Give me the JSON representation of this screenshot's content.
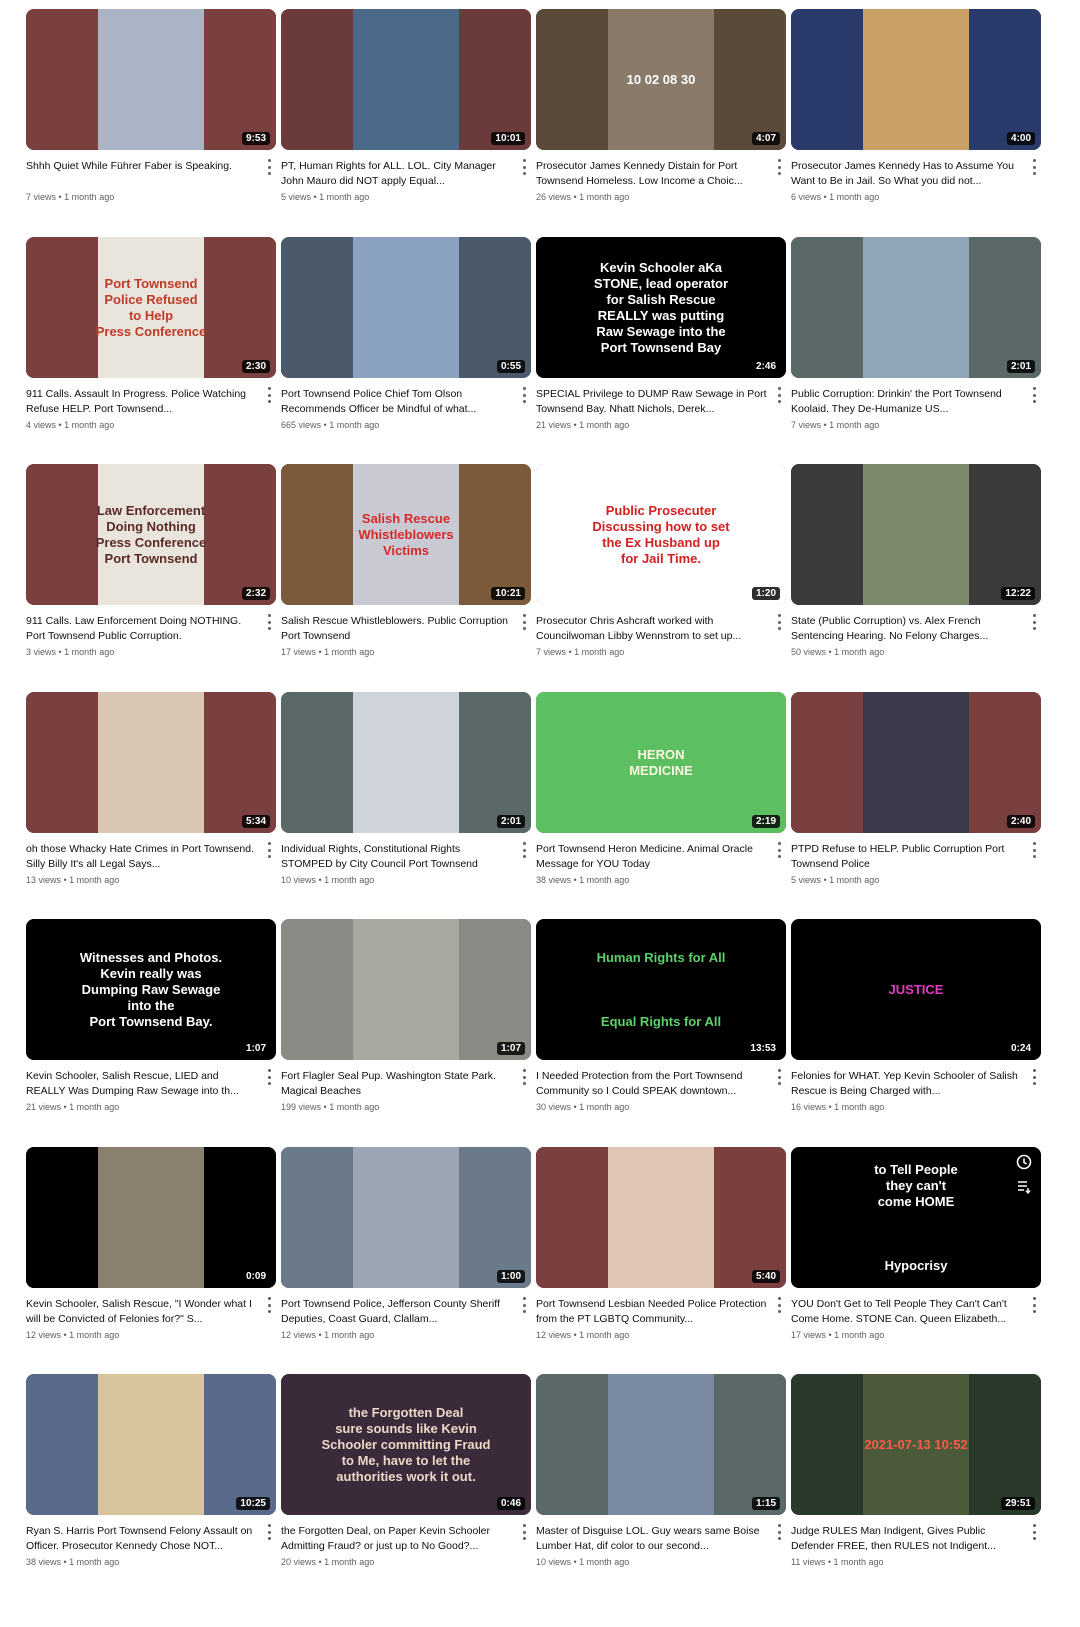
{
  "videos": [
    {
      "title": "Shhh Quiet While Führer Faber is Speaking.",
      "views": "7 views",
      "age": "1 month ago",
      "duration": "9:53",
      "overlay": "",
      "thumb": "#7a4040",
      "center": "#aab4c4",
      "fg": "#ffffff"
    },
    {
      "title": "PT, Human Rights for ALL. LOL. City Manager John Mauro did NOT apply Equal...",
      "views": "5 views",
      "age": "1 month ago",
      "duration": "10:01",
      "overlay": "",
      "thumb": "#6b3a3a",
      "center": "#4b6a8a",
      "fg": "#ffffff"
    },
    {
      "title": "Prosecutor James Kennedy Distain for Port Townsend Homeless. Low Income a Choic...",
      "views": "26 views",
      "age": "1 month ago",
      "duration": "4:07",
      "overlay": "10 02 08 30",
      "thumb": "#5a4a3a",
      "center": "#8a7a6a",
      "fg": "#ffffff"
    },
    {
      "title": "Prosecutor James Kennedy Has to Assume You Want to Be in Jail. So What you did not...",
      "views": "6 views",
      "age": "1 month ago",
      "duration": "4:00",
      "overlay": "",
      "thumb": "#2a3a6a",
      "center": "#c9a066",
      "fg": "#ffffff"
    },
    {
      "title": "911 Calls. Assault In Progress. Police Watching Refuse HELP. Port Townsend...",
      "views": "4 views",
      "age": "1 month ago",
      "duration": "2:30",
      "overlay": "Port Townsend\nPolice Refused\nto Help\nPress Conference",
      "thumb": "#7a4040",
      "center": "#e9e4dc",
      "fg": "#c23a2a"
    },
    {
      "title": "Port Townsend Police Chief Tom Olson Recommends Officer be Mindful of what...",
      "views": "665 views",
      "age": "1 month ago",
      "duration": "0:55",
      "overlay": "",
      "thumb": "#4a5a6a",
      "center": "#8aa2c0",
      "fg": "#ffffff"
    },
    {
      "title": "SPECIAL Privilege to DUMP Raw Sewage in Port Townsend Bay. Nhatt Nichols, Derek...",
      "views": "21 views",
      "age": "1 month ago",
      "duration": "2:46",
      "overlay": "Kevin Schooler aKa\nSTONE, lead operator\nfor Salish Rescue\nREALLY was putting\nRaw Sewage into the\nPort Townsend Bay",
      "thumb": "#000000",
      "center": "#000000",
      "fg": "#ffffff"
    },
    {
      "title": "Public Corruption: Drinkin' the Port Townsend Koolaid. They De-Humanize US...",
      "views": "7 views",
      "age": "1 month ago",
      "duration": "2:01",
      "overlay": "",
      "thumb": "#5a6868",
      "center": "#8fa6b8",
      "fg": "#ffffff"
    },
    {
      "title": "911 Calls. Law Enforcement Doing NOTHING. Port Townsend Public Corruption.",
      "views": "3 views",
      "age": "1 month ago",
      "duration": "2:32",
      "overlay": "Law Enforcement\nDoing Nothing\nPress Conference\nPort Townsend",
      "thumb": "#7a4040",
      "center": "#e9e4dc",
      "fg": "#5a2a2a"
    },
    {
      "title": "Salish Rescue Whistleblowers. Public Corruption Port Townsend",
      "views": "17 views",
      "age": "1 month ago",
      "duration": "10:21",
      "overlay": "Salish Rescue\nWhistleblowers\nVictims",
      "thumb": "#7a5a3a",
      "center": "#c9c9d4",
      "fg": "#d42a2a"
    },
    {
      "title": "Prosecutor Chris Ashcraft worked with Councilwoman Libby Wennstrom to set up...",
      "views": "7 views",
      "age": "1 month ago",
      "duration": "1:20",
      "overlay": "Public Prosecuter\nDiscussing how to set\nthe Ex Husband up\nfor Jail Time.",
      "thumb": "#ffffff",
      "center": "#ffffff",
      "fg": "#d42020"
    },
    {
      "title": "State (Public Corruption) vs. Alex French Sentencing Hearing. No Felony Charges...",
      "views": "50 views",
      "age": "1 month ago",
      "duration": "12:22",
      "overlay": "",
      "thumb": "#3a3a3a",
      "center": "#7a8a6a",
      "fg": "#ffffff"
    },
    {
      "title": "oh those Whacky Hate Crimes in Port Townsend. Silly Billy It's all Legal Says...",
      "views": "13 views",
      "age": "1 month ago",
      "duration": "5:34",
      "overlay": "",
      "thumb": "#7a4040",
      "center": "#d9c6b4",
      "fg": "#ffffff"
    },
    {
      "title": "Individual Rights, Constitutional Rights STOMPED by City Council Port Townsend",
      "views": "10 views",
      "age": "1 month ago",
      "duration": "2:01",
      "overlay": "",
      "thumb": "#5a6868",
      "center": "#cfd3da",
      "fg": "#ffffff"
    },
    {
      "title": "Port Townsend Heron Medicine. Animal Oracle Message for YOU Today",
      "views": "38 views",
      "age": "1 month ago",
      "duration": "2:19",
      "overlay": "HERON\nMEDICINE",
      "thumb": "#5cc063",
      "center": "#5cc063",
      "fg": "#fff6e0"
    },
    {
      "title": "PTPD Refuse to HELP. Public Corruption Port Townsend Police",
      "views": "5 views",
      "age": "1 month ago",
      "duration": "2:40",
      "overlay": "",
      "thumb": "#7a4040",
      "center": "#3a3a4a",
      "fg": "#ffffff"
    },
    {
      "title": "Kevin Schooler, Salish Rescue, LIED and REALLY Was Dumping Raw Sewage into th...",
      "views": "21 views",
      "age": "1 month ago",
      "duration": "1:07",
      "overlay": "Witnesses and Photos.\nKevin really was\nDumping Raw Sewage\ninto the\nPort Townsend Bay.",
      "thumb": "#000000",
      "center": "#000000",
      "fg": "#ffffff"
    },
    {
      "title": "Fort Flagler Seal Pup. Washington State Park. Magical Beaches",
      "views": "199 views",
      "age": "1 month ago",
      "duration": "1:07",
      "overlay": "",
      "thumb": "#8a8a84",
      "center": "#a8a8a0",
      "fg": "#ffffff"
    },
    {
      "title": "I Needed Protection from the Port Townsend Community so I Could SPEAK downtown...",
      "views": "30 views",
      "age": "1 month ago",
      "duration": "13:53",
      "overlay": "Human Rights for All\n\n\n\nEqual Rights for All",
      "thumb": "#000000",
      "center": "#000000",
      "fg": "#5cd06a"
    },
    {
      "title": "Felonies for WHAT. Yep Kevin Schooler of Salish Rescue is Being Charged with...",
      "views": "16 views",
      "age": "1 month ago",
      "duration": "0:24",
      "overlay": "JUSTICE",
      "thumb": "#000000",
      "center": "#000000",
      "fg": "#e23ac0"
    },
    {
      "title": "Kevin Schooler, Salish Rescue, \"I Wonder what I will be Convicted of Felonies for?\" S...",
      "views": "12 views",
      "age": "1 month ago",
      "duration": "0:09",
      "overlay": "",
      "thumb": "#000000",
      "center": "#8a8070",
      "fg": "#ffffff"
    },
    {
      "title": "Port Townsend Police, Jefferson County Sheriff Deputies, Coast Guard, Clallam...",
      "views": "12 views",
      "age": "1 month ago",
      "duration": "1:00",
      "overlay": "",
      "thumb": "#6a7a8a",
      "center": "#9aa6b4",
      "fg": "#ffffff"
    },
    {
      "title": "Port Townsend Lesbian Needed Police Protection from the PT LGBTQ Community...",
      "views": "12 views",
      "age": "1 month ago",
      "duration": "5:40",
      "overlay": "",
      "thumb": "#7a4040",
      "center": "#e0c4b4",
      "fg": "#ffffff"
    },
    {
      "title": "YOU Don't Get to Tell People They Can't Can't Come Home. STONE Can. Queen Elizabeth...",
      "views": "17 views",
      "age": "1 month ago",
      "duration": "",
      "overlay": "to Tell People\nthey can't\ncome HOME\n\n\n\nHypocrisy",
      "thumb": "#000000",
      "center": "#000000",
      "fg": "#ffffff"
    },
    {
      "title": "Ryan S. Harris Port Townsend Felony Assault on Officer. Prosecutor Kennedy Chose NOT...",
      "views": "38 views",
      "age": "1 month ago",
      "duration": "10:25",
      "overlay": "",
      "thumb": "#5a6a8a",
      "center": "#d8c49a",
      "fg": "#ffffff"
    },
    {
      "title": "the Forgotten Deal, on Paper Kevin Schooler Admitting Fraud? or just up to No Good?...",
      "views": "20 views",
      "age": "1 month ago",
      "duration": "0:46",
      "overlay": "the Forgotten Deal\nsure sounds like Kevin\nSchooler committing Fraud\nto Me, have to let the\nauthorities work it out.",
      "thumb": "#3a2a3a",
      "center": "#3a2a3a",
      "fg": "#e8d8c8"
    },
    {
      "title": "Master of Disguise LOL. Guy wears same Boise Lumber Hat, dif color to our second...",
      "views": "10 views",
      "age": "1 month ago",
      "duration": "1:15",
      "overlay": "",
      "thumb": "#5a6868",
      "center": "#7a8aa0",
      "fg": "#ffffff"
    },
    {
      "title": "Judge RULES Man Indigent, Gives Public Defender FREE, then RULES not Indigent...",
      "views": "11 views",
      "age": "1 month ago",
      "duration": "29:51",
      "overlay": "2021-07-13 10:52",
      "thumb": "#2a3a2a",
      "center": "#4a5a3a",
      "fg": "#ff5a4a"
    }
  ]
}
